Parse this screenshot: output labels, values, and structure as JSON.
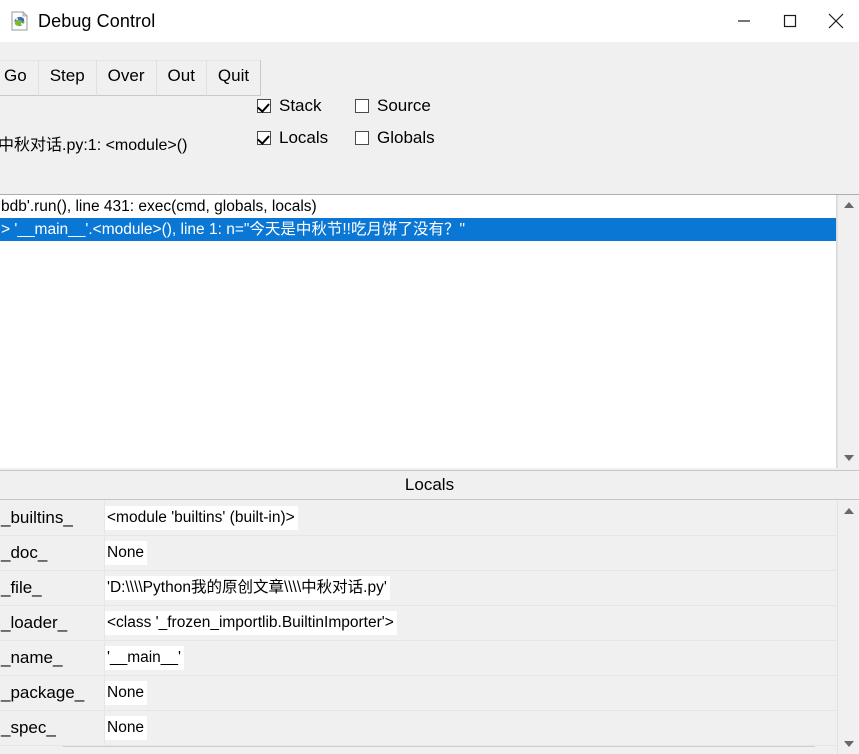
{
  "window": {
    "title": "Debug Control",
    "icon": "idle-debug-icon",
    "controls": {
      "minimize": "minimize-icon",
      "maximize": "maximize-icon",
      "close": "close-icon"
    }
  },
  "toolbar": {
    "buttons": [
      {
        "label": "Go"
      },
      {
        "label": "Step"
      },
      {
        "label": "Over"
      },
      {
        "label": "Out"
      },
      {
        "label": "Quit"
      }
    ],
    "checkboxes": [
      {
        "label": "Stack",
        "checked": true
      },
      {
        "label": "Source",
        "checked": false
      },
      {
        "label": "Locals",
        "checked": true
      },
      {
        "label": "Globals",
        "checked": false
      }
    ]
  },
  "status": {
    "line": "中秋对话.py:1: <module>()"
  },
  "stack": {
    "rows": [
      {
        "text": "bdb'.run(), line 431: exec(cmd, globals, locals)",
        "selected": false
      },
      {
        "text": "> '__main__'.<module>(), line 1: n=\"今天是中秋节!!吃月饼了没有？\"",
        "selected": true
      }
    ],
    "scrollbar": {
      "up": "scroll-up-arrow",
      "down": "scroll-down-arrow"
    }
  },
  "locals": {
    "header": "Locals",
    "rows": [
      {
        "name": "_builtins_",
        "value": "<module 'builtins' (built-in)>"
      },
      {
        "name": "_doc_",
        "value": "None"
      },
      {
        "name": "_file_",
        "value": "'D:\\\\\\\\Python我的原创文章\\\\\\\\中秋对话.py'"
      },
      {
        "name": "_loader_",
        "value": "<class '_frozen_importlib.BuiltinImporter'>"
      },
      {
        "name": "_name_",
        "value": "'__main__'"
      },
      {
        "name": "_package_",
        "value": "None"
      },
      {
        "name": "_spec_",
        "value": "None"
      }
    ],
    "scrollbar": {
      "up": "scroll-up-arrow",
      "down": "scroll-down-arrow"
    }
  },
  "colors": {
    "selection": "#0b77d4",
    "window_bg": "#f0f0f0",
    "list_bg": "#ffffff"
  }
}
